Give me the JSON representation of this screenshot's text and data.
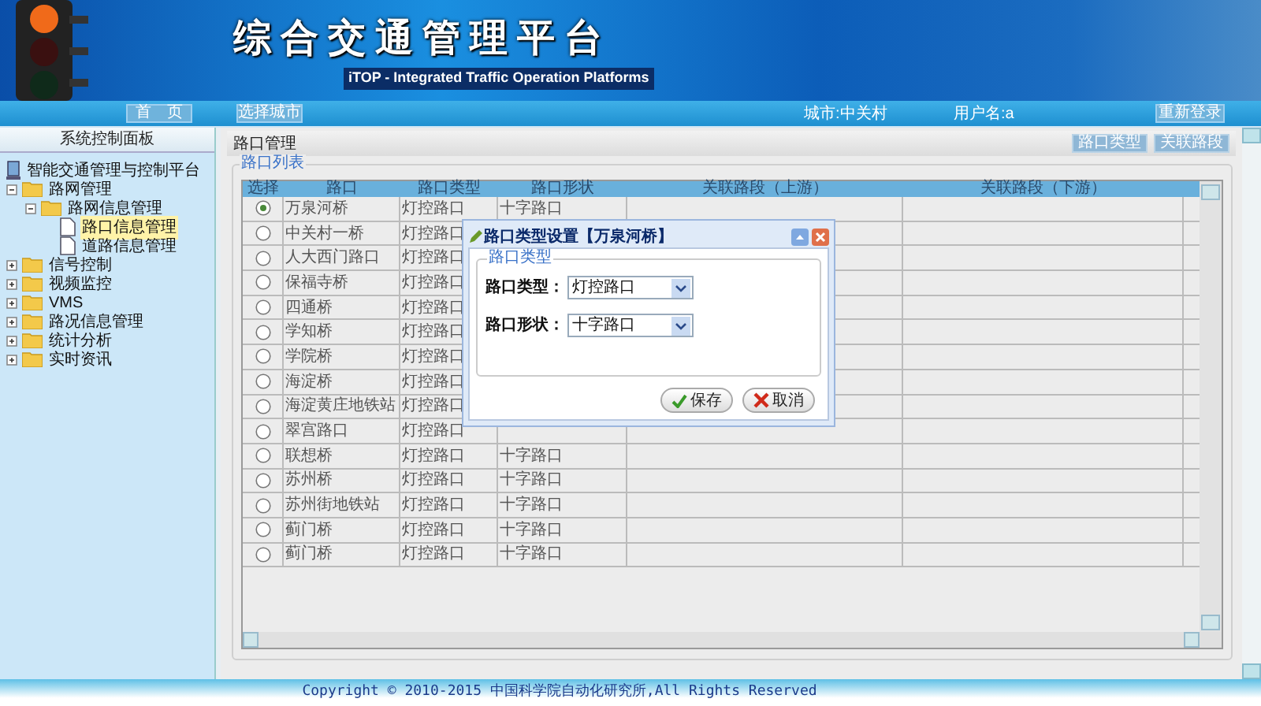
{
  "header": {
    "title": "综合交通管理平台",
    "subtitle": "iTOP - Integrated Traffic Operation Platforms"
  },
  "nav": {
    "home": "首　页",
    "city_button": "选择城市",
    "city": "城市:中关村",
    "user": "用户名:a",
    "relogin": "重新登录"
  },
  "sidebar": {
    "title": "系统控制面板",
    "tree": [
      {
        "label": "智能交通管理与控制平台",
        "kind": "root",
        "children": [
          {
            "label": "路网管理",
            "kind": "folder",
            "expanded": true,
            "children": [
              {
                "label": "路网信息管理",
                "kind": "folder",
                "expanded": true,
                "children": [
                  {
                    "label": "路口信息管理",
                    "kind": "page",
                    "selected": true
                  },
                  {
                    "label": "道路信息管理",
                    "kind": "page",
                    "selected": false
                  }
                ]
              }
            ]
          },
          {
            "label": "信号控制",
            "kind": "folder",
            "expanded": false
          },
          {
            "label": "视频监控",
            "kind": "folder",
            "expanded": false
          },
          {
            "label": "VMS",
            "kind": "folder",
            "expanded": false
          },
          {
            "label": "路况信息管理",
            "kind": "folder",
            "expanded": false
          },
          {
            "label": "统计分析",
            "kind": "folder",
            "expanded": false
          },
          {
            "label": "实时资讯",
            "kind": "folder",
            "expanded": false
          }
        ]
      }
    ]
  },
  "panel": {
    "title": "路口管理",
    "buttons": [
      "路口类型",
      "关联路段"
    ],
    "list_title": "路口列表"
  },
  "table": {
    "columns": [
      "选择",
      "路口",
      "路口类型",
      "路口形状",
      "关联路段（上游）",
      "关联路段（下游）"
    ],
    "rows": [
      {
        "selected": true,
        "name": "万泉河桥",
        "type": "灯控路口",
        "shape": "十字路口"
      },
      {
        "selected": false,
        "name": "中关村一桥",
        "type": "灯控路口"
      },
      {
        "selected": false,
        "name": "人大西门路口",
        "type": "灯控路口"
      },
      {
        "selected": false,
        "name": "保福寺桥",
        "type": "灯控路口"
      },
      {
        "selected": false,
        "name": "四通桥",
        "type": "灯控路口"
      },
      {
        "selected": false,
        "name": "学知桥",
        "type": "灯控路口"
      },
      {
        "selected": false,
        "name": "学院桥",
        "type": "灯控路口"
      },
      {
        "selected": false,
        "name": "海淀桥",
        "type": "灯控路口"
      },
      {
        "selected": false,
        "name": "海淀黄庄地铁站",
        "type": "灯控路口"
      },
      {
        "selected": false,
        "name": "翠宫路口",
        "type": "灯控路口"
      },
      {
        "selected": false,
        "name": "联想桥",
        "type": "灯控路口",
        "shape": "十字路口"
      },
      {
        "selected": false,
        "name": "苏州桥",
        "type": "灯控路口",
        "shape": "十字路口"
      },
      {
        "selected": false,
        "name": "苏州街地铁站",
        "type": "灯控路口",
        "shape": "十字路口"
      },
      {
        "selected": false,
        "name": "蓟门桥",
        "type": "灯控路口",
        "shape": "十字路口"
      },
      {
        "selected": false,
        "name": "蓟门桥",
        "type": "灯控路口",
        "shape": "十字路口"
      }
    ]
  },
  "dialog": {
    "title": "路口类型设置【万泉河桥】",
    "group": "路口类型",
    "fields": [
      {
        "label": "路口类型：",
        "value": "灯控路口"
      },
      {
        "label": "路口形状：",
        "value": "十字路口"
      }
    ],
    "save": "保存",
    "cancel": "取消"
  },
  "footer": "Copyright © 2010-2015 中国科学院自动化研究所,All Rights Reserved"
}
